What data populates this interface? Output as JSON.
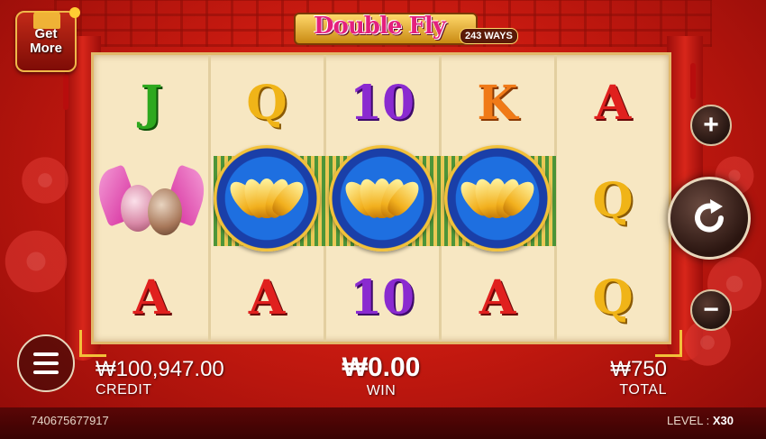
{
  "game": {
    "title": "Double Fly",
    "ways": "243 WAYS"
  },
  "get_more": {
    "label_line1": "Get",
    "label_line2": "More"
  },
  "reels": {
    "columns": [
      [
        "J",
        "mandarin-ducks",
        "A"
      ],
      [
        "Q",
        "lotus",
        "A"
      ],
      [
        "10",
        "lotus",
        "10"
      ],
      [
        "K",
        "lotus",
        "A"
      ],
      [
        "A",
        "Q",
        "Q"
      ]
    ]
  },
  "controls": {
    "plus_label": "+",
    "minus_label": "−"
  },
  "stats": {
    "credit_value": "₩100,947.00",
    "credit_label": "CREDIT",
    "win_value": "₩0.00",
    "win_label": "WIN",
    "total_value": "₩750",
    "total_label": "TOTAL"
  },
  "footer": {
    "round_id": "740675677917",
    "level_label": "LEVEL :",
    "level_value": "X30"
  },
  "colors": {
    "background": "#c81a10",
    "reel_bg": "#f7e7c2",
    "frame_gold": "#f2c13a"
  }
}
